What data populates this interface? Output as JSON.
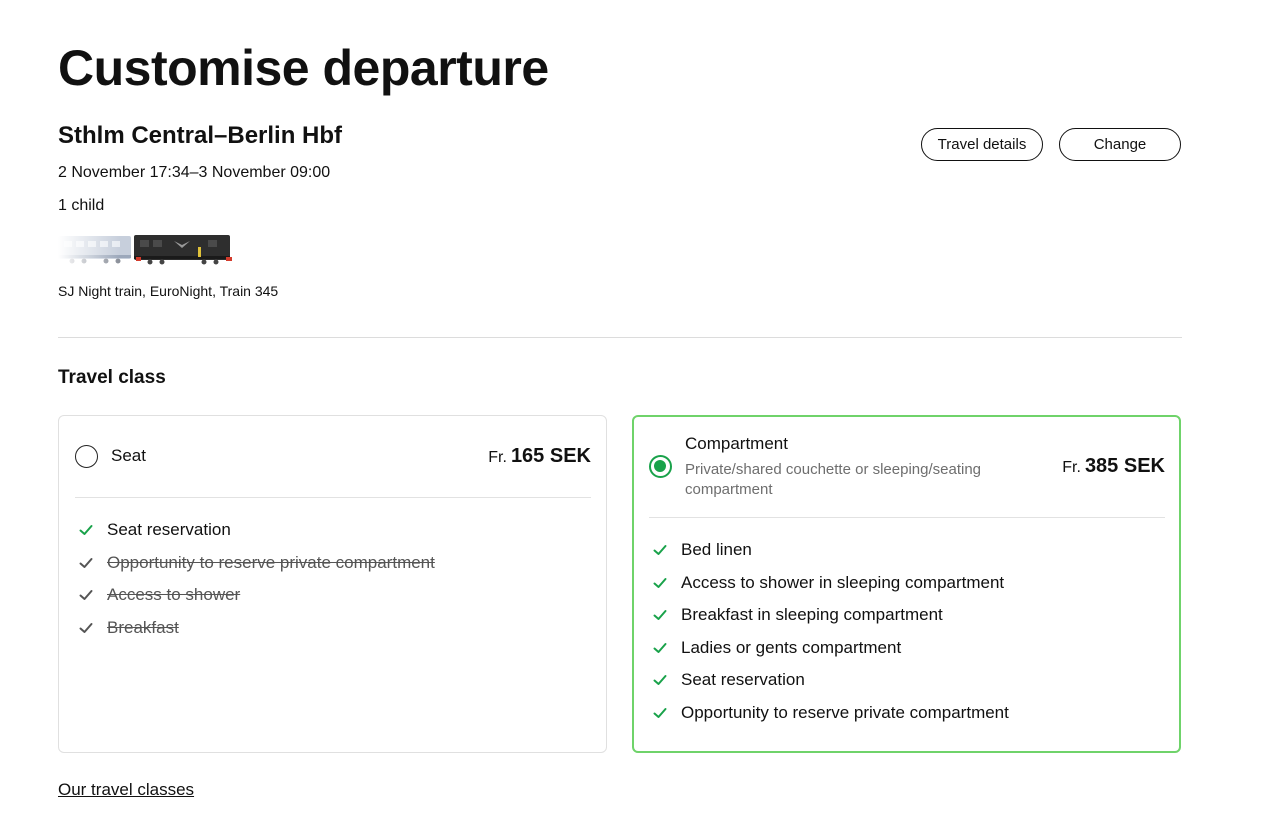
{
  "page_title": "Customise departure",
  "journey": {
    "route": "Sthlm Central–Berlin Hbf",
    "dates": "2 November 17:34–3 November 09:00",
    "passengers": "1 child",
    "train_name": "SJ Night train, EuroNight, Train 345"
  },
  "actions": {
    "travel_details": "Travel details",
    "change": "Change"
  },
  "travel_class": {
    "title": "Travel class",
    "options": [
      {
        "name": "Seat",
        "description": "",
        "price_prefix": "Fr.",
        "price": "165 SEK",
        "selected": false,
        "features": [
          {
            "label": "Seat reservation",
            "included": true
          },
          {
            "label": "Opportunity to reserve private compartment",
            "included": false
          },
          {
            "label": "Access to shower",
            "included": false
          },
          {
            "label": "Breakfast",
            "included": false
          }
        ]
      },
      {
        "name": "Compartment",
        "description": "Private/shared couchette or sleeping/seating compartment",
        "price_prefix": "Fr.",
        "price": "385 SEK",
        "selected": true,
        "features": [
          {
            "label": "Bed linen",
            "included": true
          },
          {
            "label": "Access to shower in sleeping compartment",
            "included": true
          },
          {
            "label": "Breakfast in sleeping compartment",
            "included": true
          },
          {
            "label": "Ladies or gents compartment",
            "included": true
          },
          {
            "label": "Seat reservation",
            "included": true
          },
          {
            "label": "Opportunity to reserve private compartment",
            "included": true
          }
        ]
      }
    ],
    "link": "Our travel classes"
  },
  "colors": {
    "accent_green": "#19a24a",
    "selected_border": "#6fd36a",
    "text": "#111111",
    "muted": "#6e6e6e"
  },
  "icons": {
    "check": "check-icon",
    "radio": "radio-icon",
    "train": "train-carriages-image"
  }
}
